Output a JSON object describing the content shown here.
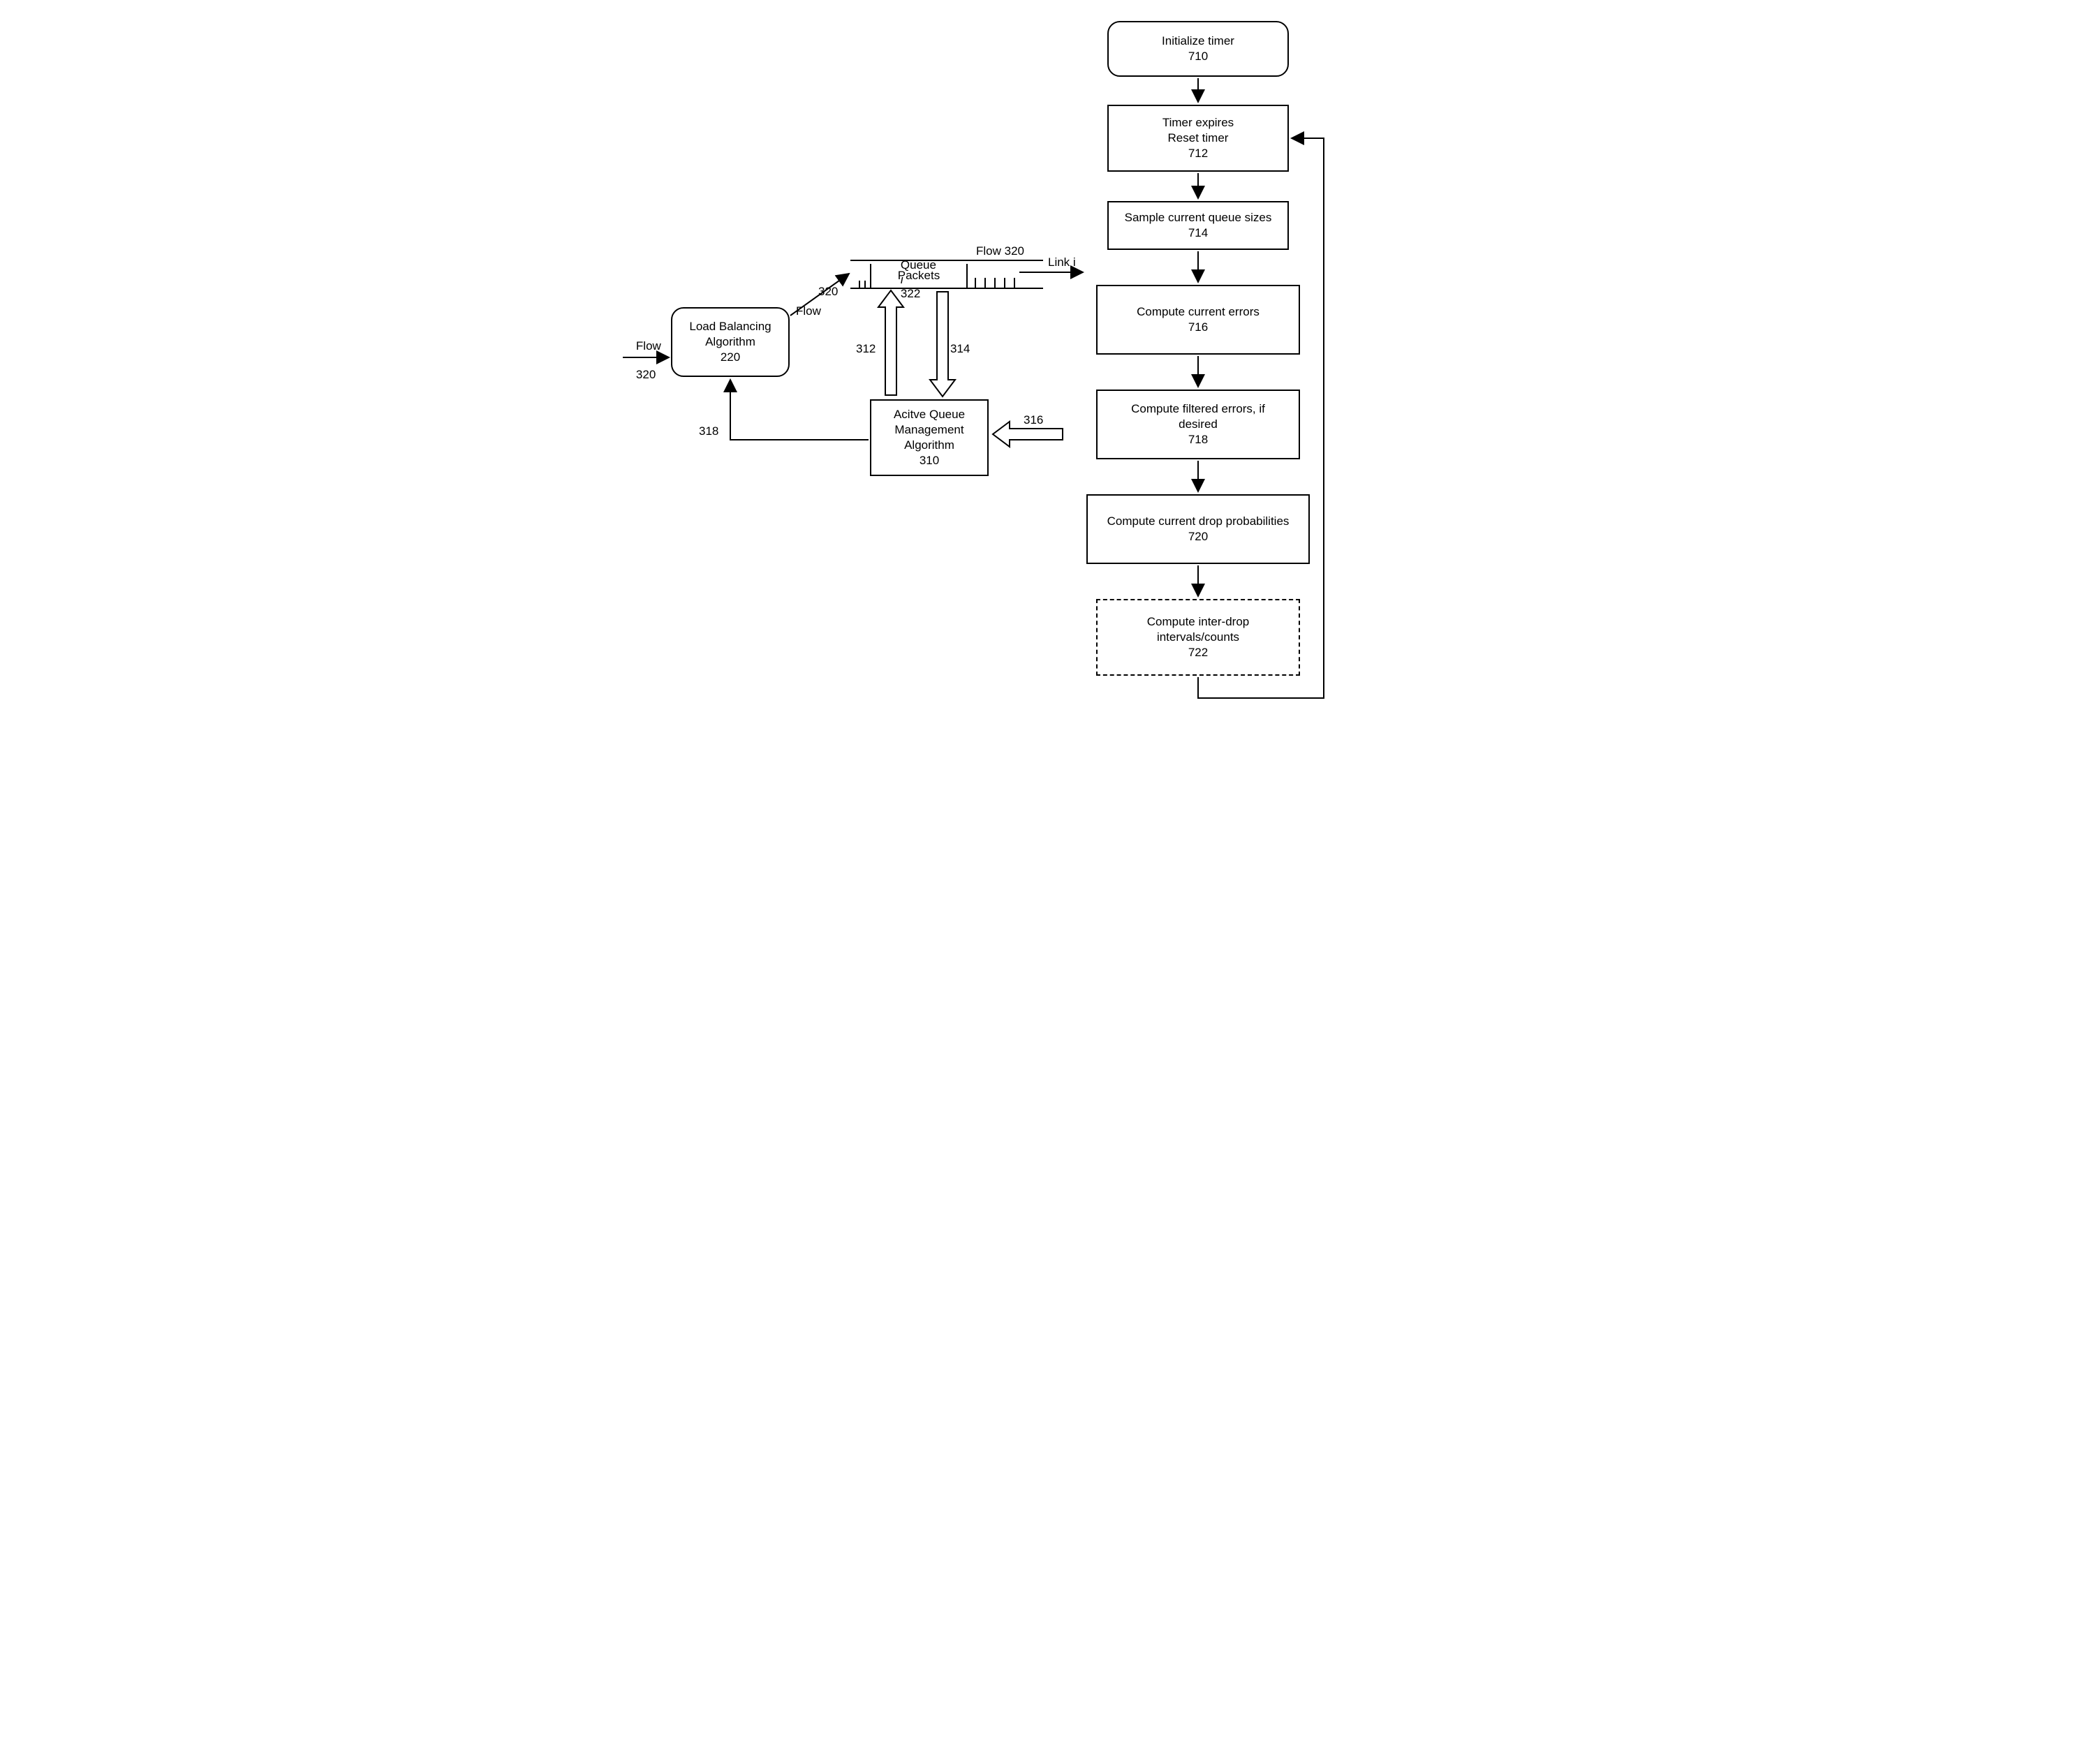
{
  "left": {
    "flow_in_label": "Flow",
    "flow_in_num": "320",
    "load_bal": {
      "l1": "Load Balancing",
      "l2": "Algorithm",
      "num": "220"
    },
    "flow_out_label": "Flow",
    "flow_out_num": "320",
    "queue_label_a": "Queue",
    "queue_label_i": "i",
    "queue_label_num": "322",
    "packets": "Packets",
    "flow_right_label": "Flow 320",
    "link_label": "Link i",
    "arrow_up_num": "312",
    "arrow_dn_num": "314",
    "aqm": {
      "l1": "Acitve Queue",
      "l2": "Management",
      "l3": "Algorithm",
      "num": "310"
    },
    "arrow_in_num": "316",
    "feedback_num": "318"
  },
  "right": {
    "b710": {
      "l1": "Initialize timer",
      "num": "710"
    },
    "b712": {
      "l1": "Timer expires",
      "l2": "Reset timer",
      "num": "712"
    },
    "b714": {
      "l1": "Sample current queue sizes",
      "num": "714"
    },
    "b716": {
      "l1": "Compute current errors",
      "num": "716"
    },
    "b718": {
      "l1": "Compute filtered errors, if",
      "l2": "desired",
      "num": "718"
    },
    "b720": {
      "l1": "Compute current drop probabilities",
      "num": "720"
    },
    "b722": {
      "l1": "Compute inter-drop",
      "l2": "intervals/counts",
      "num": "722"
    }
  }
}
